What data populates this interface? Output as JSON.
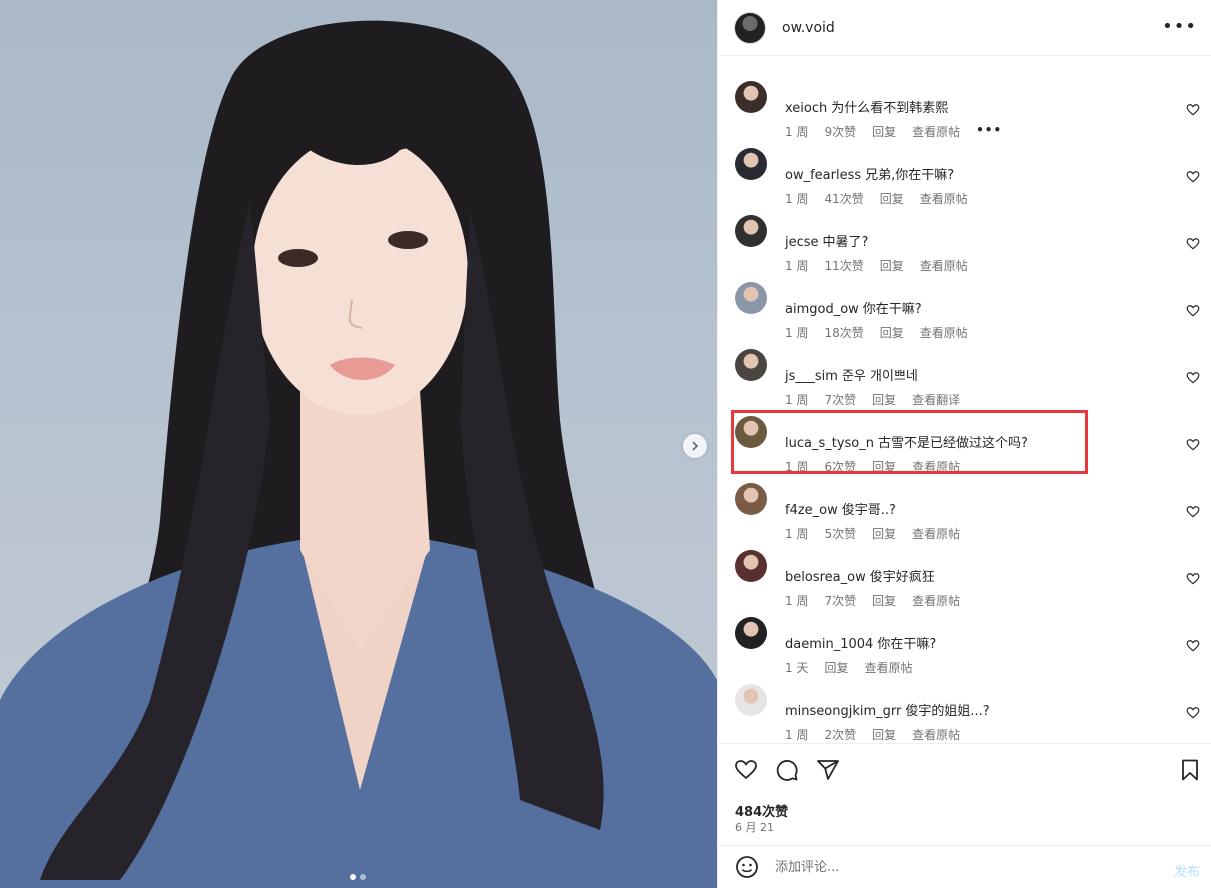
{
  "post": {
    "author": "ow.void",
    "more_icon": "more-horizontal-icon",
    "likes": "484次赞",
    "date": "6 月 21",
    "carousel": {
      "total": 2,
      "current": 1
    }
  },
  "comments": [
    {
      "user": "xeioch",
      "text": "为什么看不到韩素熙",
      "time": "1 周",
      "likes": "9次赞",
      "reply": "回复",
      "action": "查看原帖",
      "more": "•••",
      "avatar_color": "#3b2e2a"
    },
    {
      "user": "ow_fearless",
      "text": "兄弟,你在干嘛?",
      "time": "1 周",
      "likes": "41次赞",
      "reply": "回复",
      "action": "查看原帖",
      "avatar_color": "#2a2a33"
    },
    {
      "user": "jecse",
      "text": "中暑了?",
      "time": "1 周",
      "likes": "11次赞",
      "reply": "回复",
      "action": "查看原帖",
      "avatar_color": "#303030"
    },
    {
      "user": "aimgod_ow",
      "text": "你在干嘛?",
      "time": "1 周",
      "likes": "18次赞",
      "reply": "回复",
      "action": "查看原帖",
      "avatar_color": "#8a97a8"
    },
    {
      "user": "js___sim",
      "text": "준우 개이쁘네",
      "time": "1 周",
      "likes": "7次赞",
      "reply": "回复",
      "action": "查看翻译",
      "avatar_color": "#4a4540"
    },
    {
      "user": "luca_s_tyso_n",
      "text": "古雪不是已经做过这个吗?",
      "time": "1 周",
      "likes": "6次赞",
      "reply": "回复",
      "action": "查看原帖",
      "avatar_color": "#6b5a3e"
    },
    {
      "user": "f4ze_ow",
      "text": "俊宇哥..?",
      "time": "1 周",
      "likes": "5次赞",
      "reply": "回复",
      "action": "查看原帖",
      "avatar_color": "#7a5b45"
    },
    {
      "user": "belosrea_ow",
      "text": "俊宇好疯狂",
      "time": "1 周",
      "likes": "7次赞",
      "reply": "回复",
      "action": "查看原帖",
      "avatar_color": "#5a2f2f"
    },
    {
      "user": "daemin_1004",
      "text": "你在干嘛?",
      "time": "1 天",
      "likes": "",
      "reply": "回复",
      "action": "查看原帖",
      "avatar_color": "#222222"
    },
    {
      "user": "minseongjkim_grr",
      "text": "俊宇的姐姐...?",
      "time": "1 周",
      "likes": "2次赞",
      "reply": "回复",
      "action": "查看原帖",
      "avatar_color": "#e5e5e5"
    }
  ],
  "composer": {
    "placeholder": "添加评论...",
    "post_label": "发布",
    "emoji_icon": "emoji-icon"
  },
  "icons": {
    "like": "heart-icon",
    "comment": "comment-icon",
    "share": "share-icon",
    "save": "bookmark-icon",
    "next": "chevron-right-icon"
  }
}
